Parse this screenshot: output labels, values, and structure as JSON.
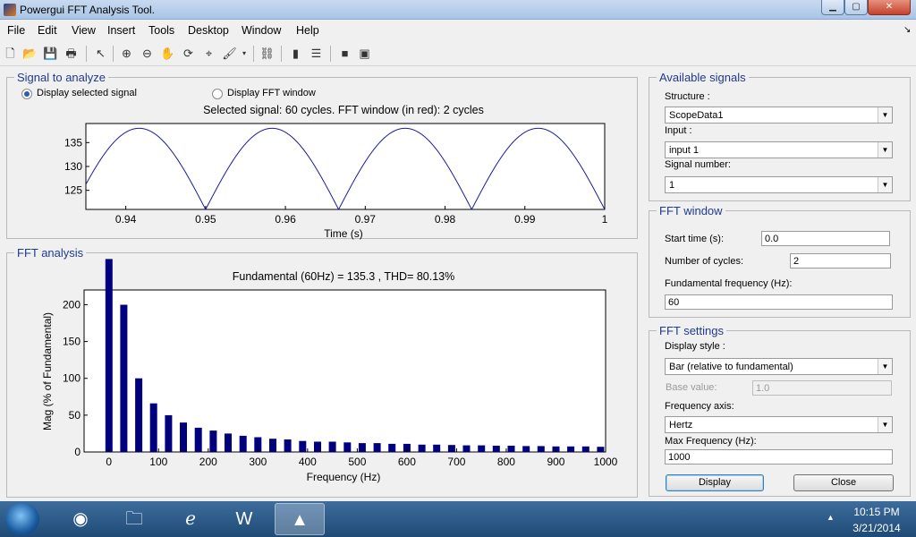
{
  "window": {
    "title": "Powergui FFT Analysis Tool."
  },
  "menu": [
    "File",
    "Edit",
    "View",
    "Insert",
    "Tools",
    "Desktop",
    "Window",
    "Help"
  ],
  "signal_panel": {
    "title": "Signal to analyze",
    "radio_selected": "Display selected signal",
    "radio_fft": "Display FFT window",
    "plot_title": "Selected signal: 60 cycles. FFT window (in red): 2 cycles",
    "xlabel": "Time (s)",
    "xticks": [
      "0.94",
      "0.95",
      "0.96",
      "0.97",
      "0.98",
      "0.99",
      "1"
    ],
    "yticks": [
      "125",
      "130",
      "135"
    ]
  },
  "fft_panel": {
    "title": "FFT analysis",
    "plot_title": "Fundamental (60Hz) = 135.3 , THD= 80.13%",
    "xlabel": "Frequency (Hz)",
    "ylabel": "Mag (% of Fundamental)",
    "xticks": [
      "0",
      "100",
      "200",
      "300",
      "400",
      "500",
      "600",
      "700",
      "800",
      "900",
      "1000"
    ],
    "yticks": [
      "0",
      "50",
      "100",
      "150",
      "200"
    ]
  },
  "available_signals": {
    "title": "Available signals",
    "structure_label": "Structure :",
    "structure_value": "ScopeData1",
    "input_label": "Input :",
    "input_value": "input 1",
    "signal_number_label": "Signal number:",
    "signal_number_value": "1"
  },
  "fft_window": {
    "title": "FFT window",
    "start_time_label": "Start time (s):",
    "start_time_value": "0.0",
    "cycles_label": "Number of cycles:",
    "cycles_value": "2",
    "fund_freq_label": "Fundamental frequency (Hz):",
    "fund_freq_value": "60"
  },
  "fft_settings": {
    "title": "FFT settings",
    "display_style_label": "Display style :",
    "display_style_value": "Bar (relative to fundamental)",
    "base_value_label": "Base value:",
    "base_value_value": "1.0",
    "freq_axis_label": "Frequency axis:",
    "freq_axis_value": "Hertz",
    "max_freq_label": "Max Frequency (Hz):",
    "max_freq_value": "1000"
  },
  "buttons": {
    "display": "Display",
    "close": "Close"
  },
  "taskbar": {
    "apps": [
      "chrome-icon",
      "explorer-icon",
      "internet-explorer-icon",
      "word-icon",
      "matlab-icon"
    ],
    "time": "10:15 PM",
    "date": "3/21/2014"
  },
  "colors": {
    "bar": "#00007f",
    "signal_line": "#1a1a9c",
    "panel_title": "#1f3a8f"
  },
  "chart_data": [
    {
      "type": "line",
      "title": "Selected signal: 60 cycles. FFT window (in red): 2 cycles",
      "xlabel": "Time (s)",
      "ylabel": "",
      "xlim": [
        0.935,
        1.0
      ],
      "ylim": [
        121,
        139
      ],
      "description_free": true,
      "series": [
        {
          "waveform": "full-wave rectified sine",
          "peak": 138,
          "trough": 121,
          "frequency_hz": 60
        }
      ]
    },
    {
      "type": "bar",
      "title": "Fundamental (60Hz) = 135.3 , THD= 80.13%",
      "xlabel": "Frequency (Hz)",
      "ylabel": "Mag (% of Fundamental)",
      "xlim": [
        -50,
        1000
      ],
      "ylim": [
        0,
        220
      ],
      "x": [
        0,
        30,
        60,
        90,
        120,
        150,
        180,
        210,
        240,
        270,
        300,
        330,
        360,
        390,
        420,
        450,
        480,
        510,
        540,
        570,
        600,
        630,
        660,
        690,
        720,
        750,
        780,
        810,
        840,
        870,
        900,
        930,
        960,
        990
      ],
      "values": [
        262,
        200,
        100,
        66,
        50,
        40,
        33,
        29,
        25,
        22,
        20,
        18,
        17,
        15,
        14,
        14,
        13,
        12,
        12,
        11,
        11,
        10,
        10,
        9.5,
        9,
        9,
        8.5,
        8.5,
        8,
        8,
        7.5,
        7.5,
        7.5,
        7
      ]
    }
  ]
}
